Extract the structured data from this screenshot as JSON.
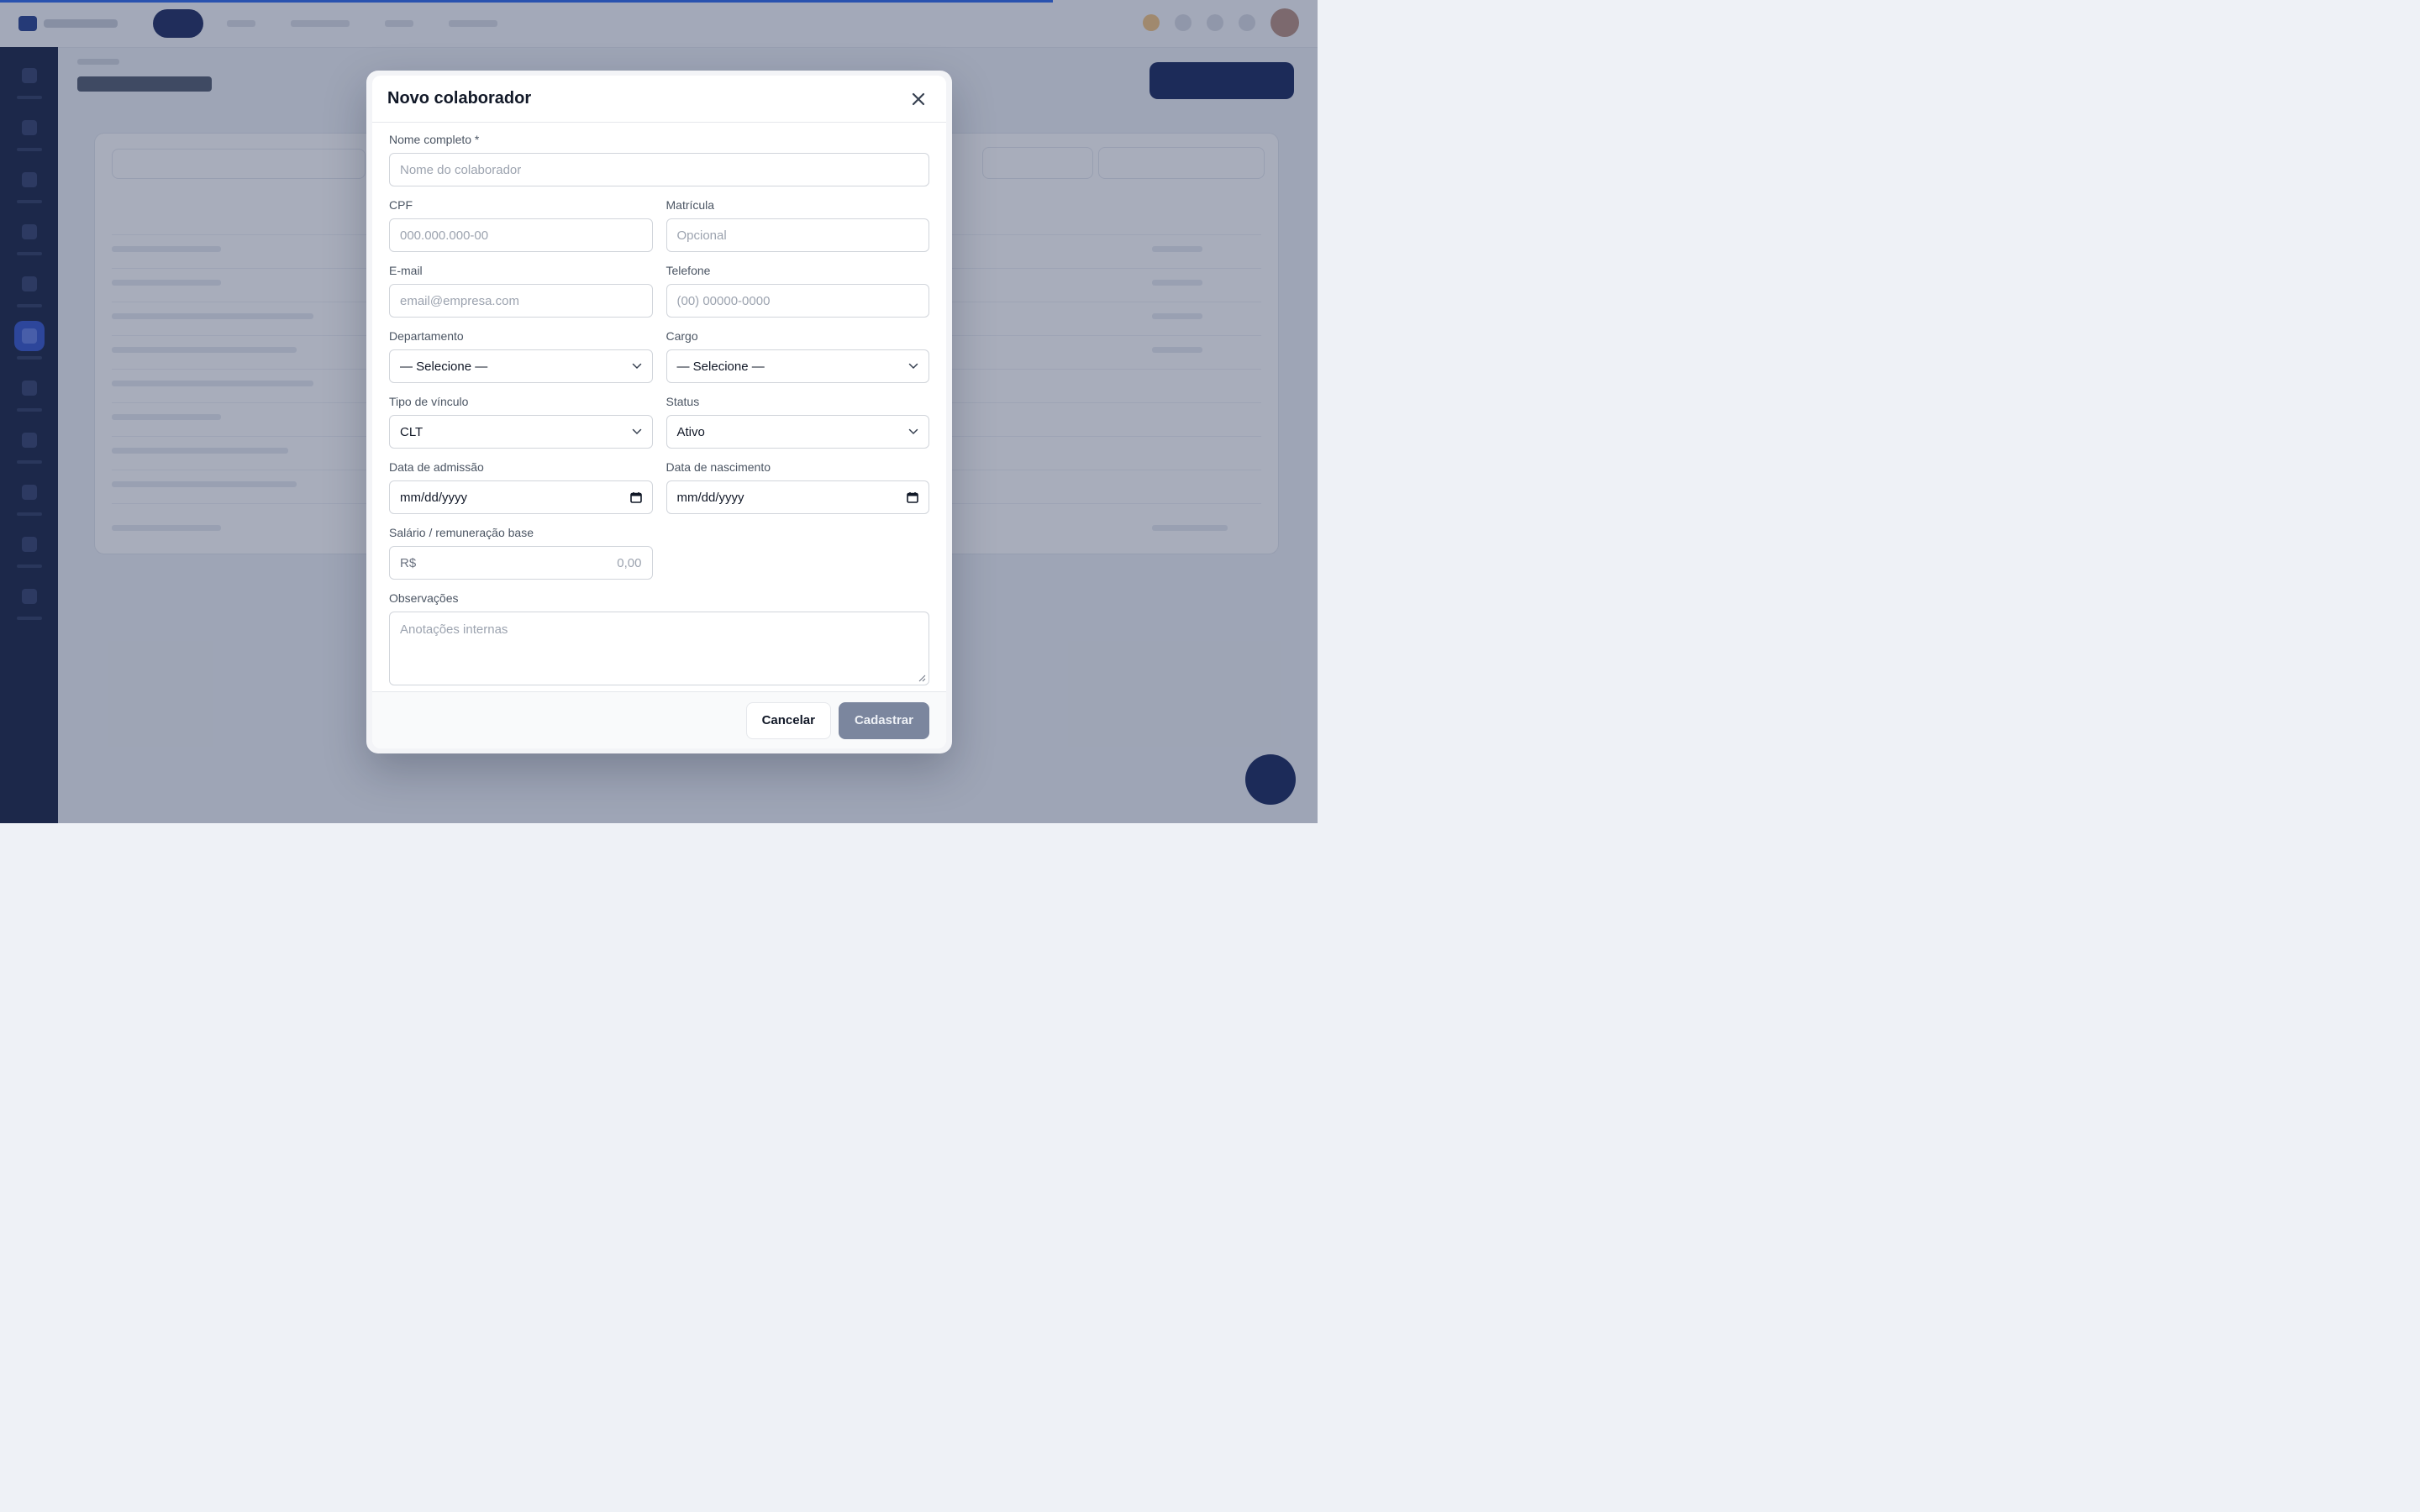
{
  "modal": {
    "title": "Novo colaborador",
    "fields": {
      "nome": {
        "label": "Nome completo *",
        "placeholder": "Nome do colaborador"
      },
      "cpf": {
        "label": "CPF",
        "placeholder": "000.000.000-00"
      },
      "matricula": {
        "label": "Matrícula",
        "placeholder": "Opcional"
      },
      "email": {
        "label": "E-mail",
        "placeholder": "email@empresa.com"
      },
      "telefone": {
        "label": "Telefone",
        "placeholder": "(00) 00000-0000"
      },
      "departamento": {
        "label": "Departamento",
        "value": "— Selecione —"
      },
      "cargo": {
        "label": "Cargo",
        "value": "— Selecione —"
      },
      "vinculo": {
        "label": "Tipo de vínculo",
        "value": "CLT"
      },
      "status": {
        "label": "Status",
        "value": "Ativo"
      },
      "admissao": {
        "label": "Data de admissão",
        "placeholder": "mm/dd/yyyy"
      },
      "nascimento": {
        "label": "Data de nascimento",
        "placeholder": "mm/dd/yyyy"
      },
      "salario": {
        "label": "Salário / remuneração base",
        "prefix": "R$",
        "placeholder": "0,00"
      },
      "observacoes": {
        "label": "Observações",
        "placeholder": "Anotações internas"
      }
    },
    "buttons": {
      "cancel": "Cancelar",
      "submit": "Cadastrar"
    }
  },
  "icons": {
    "close": "close-icon",
    "select": "chevron-down-icon",
    "date": "calendar-icon"
  },
  "colors": {
    "accent": "#2563eb",
    "navy": "#0f1f57",
    "submit_disabled": "#7b869e"
  }
}
